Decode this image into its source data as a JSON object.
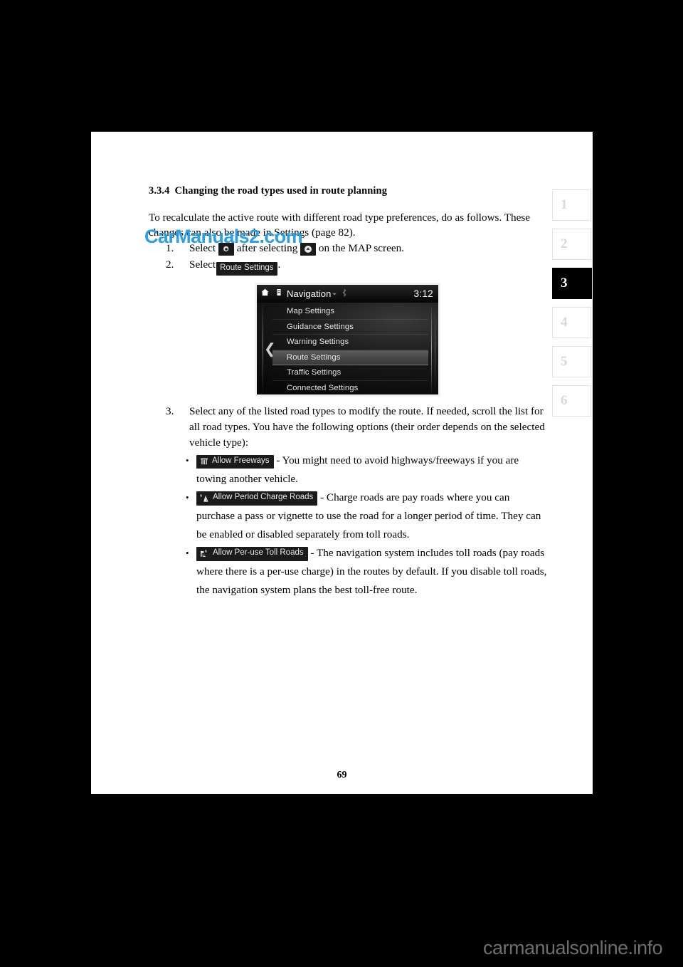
{
  "document": {
    "page_number": "69",
    "section": {
      "number": "3.3.4",
      "title": "Changing the road types used in route planning"
    },
    "intro": "To recalculate the active route with different road type preferences, do as follows. These changes can also be made in Settings (page 82).",
    "steps": [
      {
        "marker": "1.",
        "text_before_icon1": "Select",
        "icon1": "gear-icon",
        "text_between": "after selecting",
        "icon2": "chevron-up-circle-icon",
        "text_after": "on the MAP screen."
      },
      {
        "marker": "2.",
        "text_before_chip": "Select",
        "chip_label": "Route Settings",
        "text_after": "."
      },
      {
        "marker": "3.",
        "text": "Select any of the listed road types to modify the route. If needed, scroll the list for all road types. You have the following options (their order depends on the selected vehicle type):"
      }
    ],
    "road_type_options": [
      {
        "icon": "freeway-icon",
        "chip_label": "Allow Freeways",
        "description": "- You might need to avoid highways/freeways if you are towing another vehicle."
      },
      {
        "icon": "period-charge-road-icon",
        "chip_label": "Allow Period Charge Roads",
        "description": "- Charge roads are pay roads where you can purchase a pass or vignette to use the road for a longer period of time. They can be enabled or disabled separately from toll roads."
      },
      {
        "icon": "per-use-toll-road-icon",
        "chip_label": "Allow Per-use Toll Roads",
        "description": "- The navigation system includes toll roads (pay roads where there is a per-use charge) in the routes by default. If you disable toll roads, the navigation system plans the best toll-free route."
      }
    ]
  },
  "device_screenshot": {
    "header": {
      "home_icon": "home-icon",
      "app_icon": "navigation-app-icon",
      "title": "Navigation",
      "status_icons": [
        "chevron-down-icon",
        "bluetooth-icon"
      ],
      "clock": "3:12"
    },
    "back_icon": "back-chevron-icon",
    "menu_items": [
      {
        "label": "Map Settings",
        "selected": false
      },
      {
        "label": "Guidance Settings",
        "selected": false
      },
      {
        "label": "Warning Settings",
        "selected": false
      },
      {
        "label": "Route Settings",
        "selected": true
      },
      {
        "label": "Traffic Settings",
        "selected": false
      },
      {
        "label": "Connected Settings",
        "selected": false
      }
    ]
  },
  "tab_strip": {
    "tabs": [
      {
        "label": "1",
        "active": false
      },
      {
        "label": "2",
        "active": false
      },
      {
        "label": "3",
        "active": true
      },
      {
        "label": "4",
        "active": false
      },
      {
        "label": "5",
        "active": false
      },
      {
        "label": "6",
        "active": false
      }
    ]
  },
  "watermarks": {
    "middle": "CarManuals2.com",
    "bottom": "carmanualsonline.info"
  },
  "colors": {
    "watermark_middle": "#2f9fe0",
    "watermark_bottom": "#6e6e6e",
    "chip_background": "#1b1b1b",
    "page_background": "#ffffff",
    "outer_background": "#000000"
  }
}
